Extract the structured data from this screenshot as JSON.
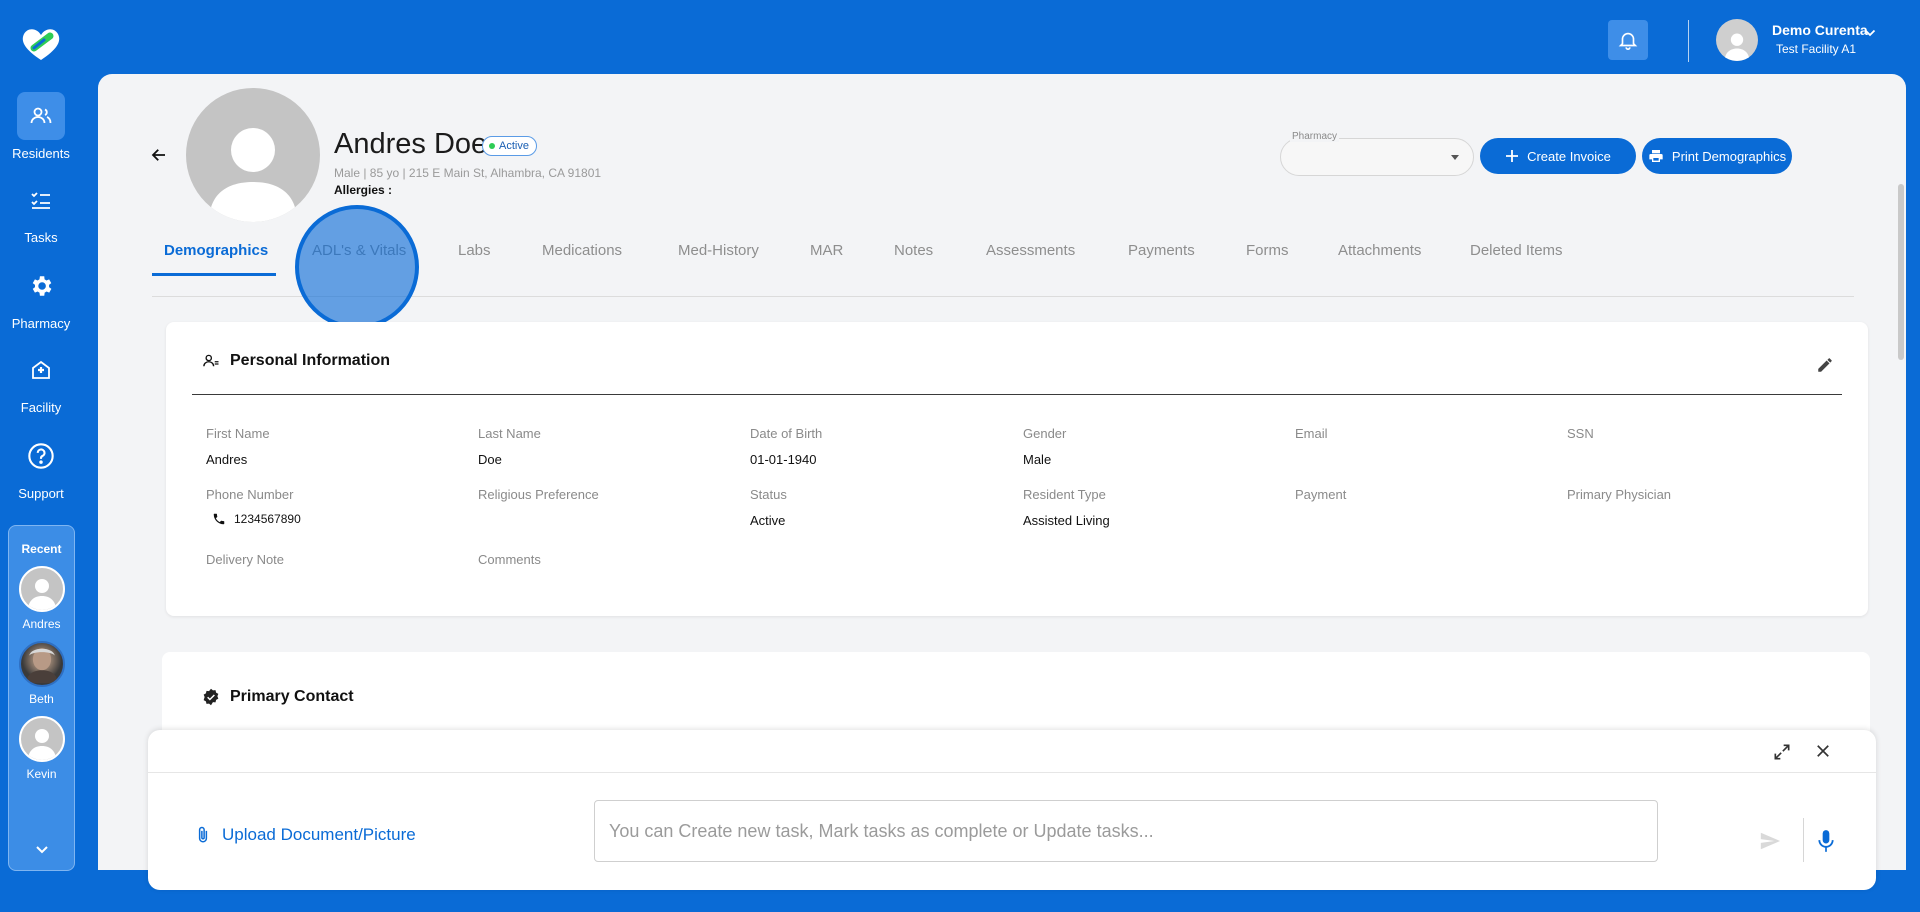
{
  "nav": {
    "items": [
      {
        "label": "Residents",
        "icon": "residents-icon"
      },
      {
        "label": "Tasks",
        "icon": "tasks-icon"
      },
      {
        "label": "Pharmacy",
        "icon": "gear-icon"
      },
      {
        "label": "Facility",
        "icon": "facility-icon"
      },
      {
        "label": "Support",
        "icon": "help-icon"
      }
    ],
    "recent_title": "Recent",
    "recent": [
      {
        "name": "Andres"
      },
      {
        "name": "Beth"
      },
      {
        "name": "Kevin"
      }
    ]
  },
  "user": {
    "name": "Demo Curenta",
    "facility": "Test Facility A1"
  },
  "resident": {
    "name": "Andres Doe",
    "status": "Active",
    "meta": "Male | 85 yo | 215 E Main St, Alhambra, CA 91801",
    "allergies_label": "Allergies :"
  },
  "header_actions": {
    "pharmacy_label": "Pharmacy",
    "pharmacy_value": "",
    "create_invoice": "Create Invoice",
    "print_demographics": "Print Demographics"
  },
  "tabs": [
    "Demographics",
    "ADL's & Vitals",
    "Labs",
    "Medications",
    "Med-History",
    "MAR",
    "Notes",
    "Assessments",
    "Payments",
    "Forms",
    "Attachments",
    "Deleted Items"
  ],
  "personal_info": {
    "title": "Personal Information",
    "fields": {
      "first_name": {
        "label": "First Name",
        "value": "Andres"
      },
      "last_name": {
        "label": "Last Name",
        "value": "Doe"
      },
      "dob": {
        "label": "Date of Birth",
        "value": "01-01-1940"
      },
      "gender": {
        "label": "Gender",
        "value": "Male"
      },
      "email": {
        "label": "Email",
        "value": ""
      },
      "ssn": {
        "label": "SSN",
        "value": ""
      },
      "phone": {
        "label": "Phone Number",
        "value": "1234567890"
      },
      "religion": {
        "label": "Religious Preference",
        "value": ""
      },
      "status": {
        "label": "Status",
        "value": "Active"
      },
      "resident_type": {
        "label": "Resident Type",
        "value": "Assisted Living"
      },
      "payment": {
        "label": "Payment",
        "value": ""
      },
      "physician": {
        "label": "Primary Physician",
        "value": ""
      },
      "delivery_note": {
        "label": "Delivery Note",
        "value": ""
      },
      "comments": {
        "label": "Comments",
        "value": ""
      }
    }
  },
  "primary_contact": {
    "title": "Primary Contact"
  },
  "chat": {
    "upload_label": "Upload Document/Picture",
    "input_placeholder": "You can Create new task, Mark tasks as complete or Update tasks...",
    "input_value": ""
  },
  "colors": {
    "brand": "#0a6bd6",
    "active_dot": "#2ecc55"
  }
}
